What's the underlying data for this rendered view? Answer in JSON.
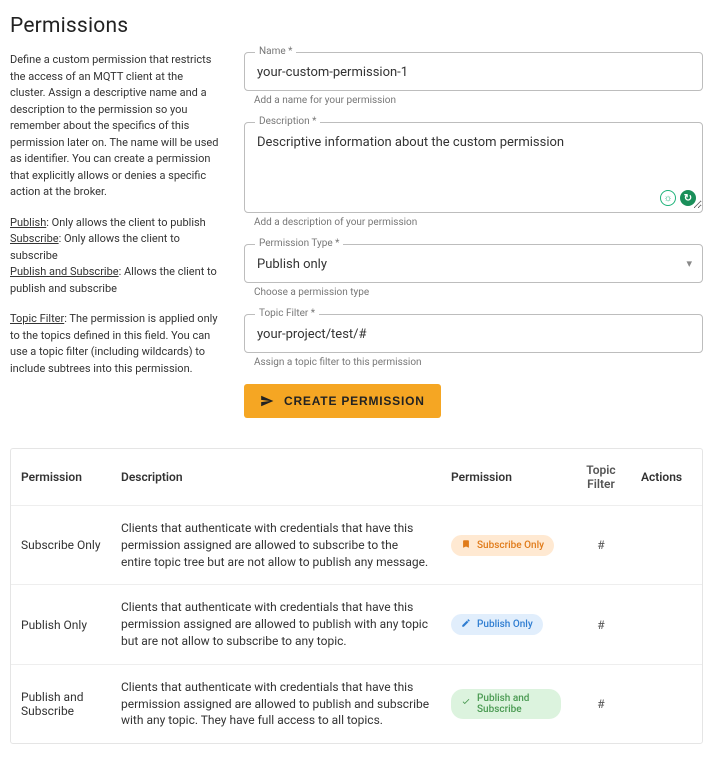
{
  "title": "Permissions",
  "help": {
    "intro": "Define a custom permission that restricts the access of an MQTT client at the cluster. Assign a descriptive name and a description to the permission so you remember about the specifics of this permission later on. The name will be used as identifier. You can create a permission that explicitly allows or denies a specific action at the broker.",
    "pub_label": "Publish",
    "pub_text": ": Only allows the client to publish",
    "sub_label": "Subscribe",
    "sub_text": ": Only allows the client to subscribe",
    "both_label": "Publish and Subscribe",
    "both_text": ": Allows the client to publish and subscribe",
    "filter_label": "Topic Filter",
    "filter_text": ": The permission is applied only to the topics defined in this field. You can use a topic filter (including wildcards) to include subtrees into this permission."
  },
  "form": {
    "name": {
      "label": "Name *",
      "value": "your-custom-permission-1",
      "hint": "Add a name for your permission"
    },
    "description": {
      "label": "Description *",
      "value": "Descriptive information about the custom permission",
      "hint": "Add a description of your permission"
    },
    "type": {
      "label": "Permission Type *",
      "value": "Publish only",
      "hint": "Choose a permission type"
    },
    "filter": {
      "label": "Topic Filter *",
      "value": "your-project/test/#",
      "hint": "Assign a topic filter to this permission"
    },
    "submit": "CREATE PERMISSION"
  },
  "table": {
    "headers": {
      "name": "Permission",
      "desc": "Description",
      "badge": "Permission",
      "filter": "Topic Filter",
      "actions": "Actions"
    },
    "rows": [
      {
        "name": "Subscribe Only",
        "desc": "Clients that authenticate with credentials that have this permission assigned are allowed to subscribe to the entire topic tree but are not allow to publish any message.",
        "badge": "Subscribe Only",
        "badge_kind": "sub",
        "filter": "#"
      },
      {
        "name": "Publish Only",
        "desc": "Clients that authenticate with credentials that have this permission assigned are allowed to publish with any topic but are not allow to subscribe to any topic.",
        "badge": "Publish Only",
        "badge_kind": "pub",
        "filter": "#"
      },
      {
        "name": "Publish and Subscribe",
        "desc": "Clients that authenticate with credentials that have this permission assigned are allowed to publish and subscribe with any topic. They have full access to all topics.",
        "badge": "Publish and Subscribe",
        "badge_kind": "both",
        "filter": "#"
      }
    ]
  }
}
